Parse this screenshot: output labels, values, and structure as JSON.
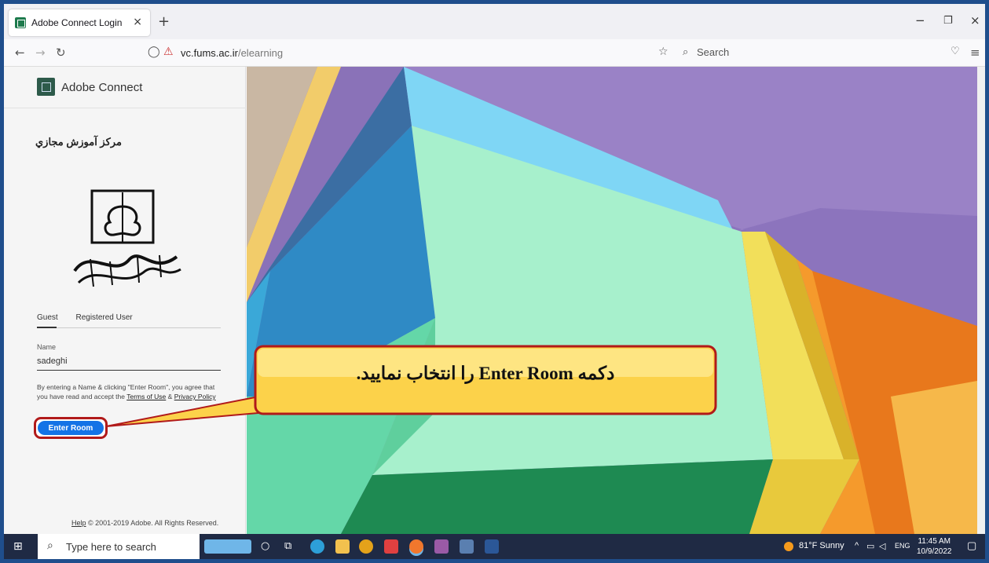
{
  "browser": {
    "tab_title": "Adobe Connect Login",
    "tab_close": "×",
    "new_tab": "+",
    "url_host": "vc.fums.ac.ir",
    "url_path": "/elearning",
    "search_placeholder": "Search",
    "window_controls": {
      "minimize": "−",
      "restore": "❐",
      "close": "×"
    }
  },
  "login": {
    "brand": "Adobe Connect",
    "center_name": "مرکز آموزش مجازي",
    "tabs": [
      "Guest",
      "Registered User"
    ],
    "name_label": "Name",
    "name_value": "sadeghi",
    "disclaimer_prefix": "By entering a Name & clicking \"Enter Room\", you agree that you have read and accept the ",
    "terms_link": "Terms of Use",
    "amp": " & ",
    "privacy_link": "Privacy Policy",
    "enter_button": "Enter Room",
    "help_link": "Help",
    "copyright": " © 2001-2019 Adobe. All Rights Reserved."
  },
  "callout": {
    "text": "دکمه Enter Room را انتخاب نمایید."
  },
  "taskbar": {
    "search_placeholder": "Type here to search",
    "weather": "81°F  Sunny",
    "language": "ENG",
    "time": "11:45 AM",
    "date": "10/9/2022"
  },
  "colors": {
    "accent_button": "#1473e6",
    "highlight_border": "#b11a1a",
    "callout_fill": "#fcd24a",
    "taskbar": "#1f2a44"
  }
}
